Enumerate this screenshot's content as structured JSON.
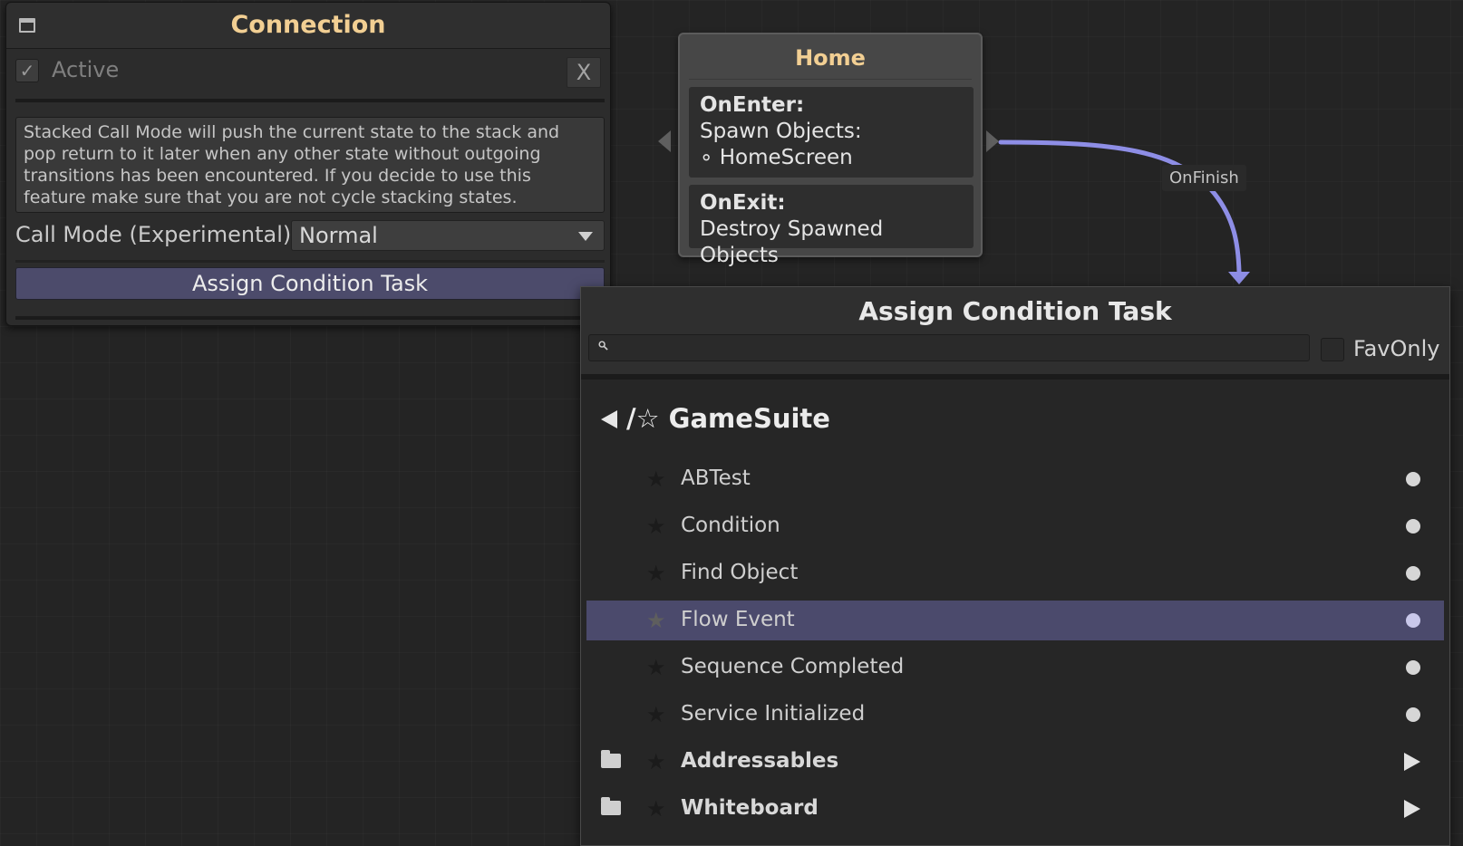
{
  "connection_panel": {
    "title": "Connection",
    "active_label": "Active",
    "active_checked": true,
    "check_glyph": "✓",
    "close_label": "X",
    "info_text": "Stacked Call Mode will push the current state to the stack and pop return to it later when any other state without outgoing transitions has been encountered. If you decide to use this feature make sure that you are not cycle stacking states.",
    "call_mode_label": "Call Mode (Experimental)",
    "call_mode_value": "Normal",
    "assign_button_label": "Assign Condition Task"
  },
  "home_node": {
    "title": "Home",
    "on_enter_label": "OnEnter:",
    "on_enter_action": "Spawn Objects:",
    "on_enter_item": "∘ HomeScreen",
    "on_exit_label": "OnExit:",
    "on_exit_action": "Destroy Spawned Objects"
  },
  "connection": {
    "label": "OnFinish",
    "color": "#8e8ee6"
  },
  "task_browser": {
    "title": "Assign Condition Task",
    "search_value": "",
    "favonly_label": "FavOnly",
    "favonly_checked": false,
    "category_title": "/☆ GameSuite",
    "star_glyph": "★",
    "items": [
      {
        "label": "ABTest",
        "type": "task"
      },
      {
        "label": "Condition",
        "type": "task"
      },
      {
        "label": "Find Object",
        "type": "task"
      },
      {
        "label": "Flow Event",
        "type": "task",
        "selected": true
      },
      {
        "label": "Sequence Completed",
        "type": "task"
      },
      {
        "label": "Service Initialized",
        "type": "task"
      },
      {
        "label": "Addressables",
        "type": "folder"
      },
      {
        "label": "Whiteboard",
        "type": "folder"
      }
    ]
  },
  "colors": {
    "title_accent": "#f2cf93",
    "selection": "#4b4a6c",
    "button": "#4c4b6b"
  }
}
